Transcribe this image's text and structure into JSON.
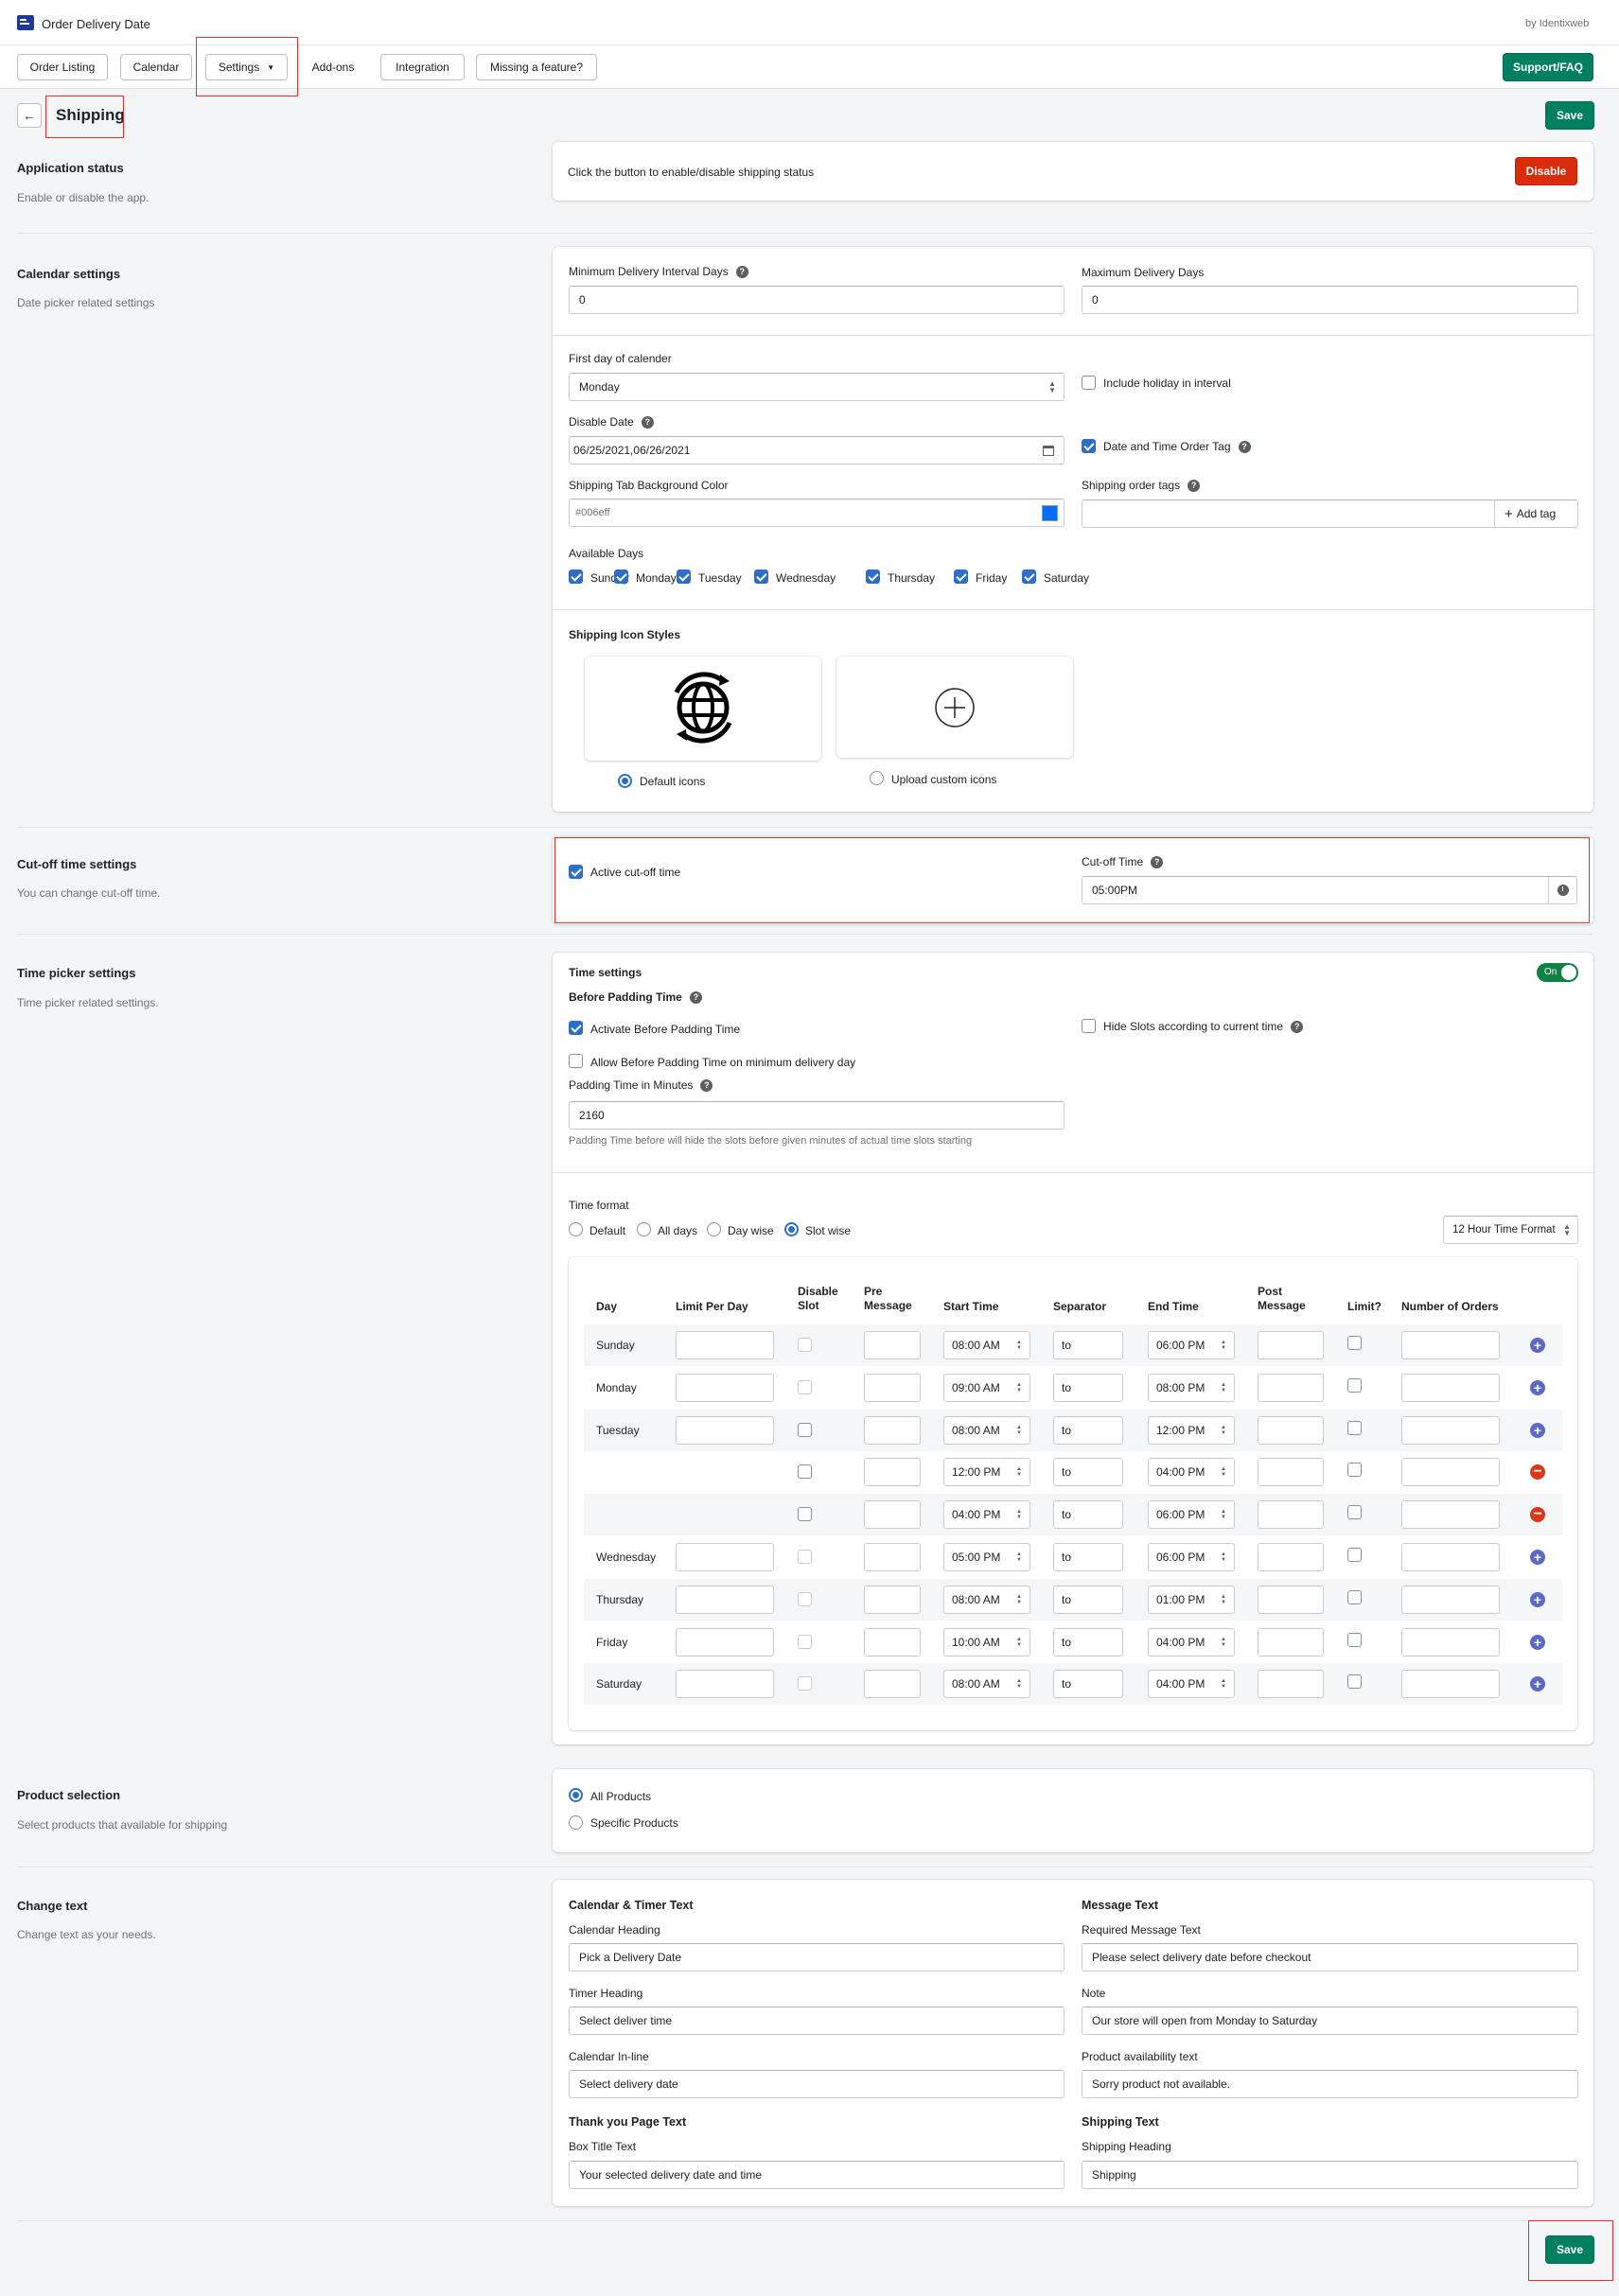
{
  "app": {
    "title": "Order Delivery Date",
    "vendor": "by Identixweb"
  },
  "nav": {
    "order_listing": "Order Listing",
    "calendar": "Calendar",
    "settings": "Settings",
    "addons": "Add-ons",
    "integration": "Integration",
    "missing": "Missing a feature?",
    "support": "Support/FAQ"
  },
  "page": {
    "title": "Shipping",
    "save": "Save"
  },
  "app_status": {
    "title": "Application status",
    "desc": "Enable or disable the app.",
    "text": "Click the button to enable/disable shipping status",
    "button": "Disable"
  },
  "calendar": {
    "title": "Calendar settings",
    "desc": "Date picker related settings",
    "min_label": "Minimum Delivery Interval Days",
    "min_value": "0",
    "max_label": "Maximum Delivery Days",
    "max_value": "0",
    "first_day_label": "First day of calender",
    "first_day_value": "Monday",
    "include_holiday": "Include holiday in interval",
    "disable_date_label": "Disable Date",
    "disable_date_value": "06/25/2021,06/26/2021",
    "order_tag": "Date and Time Order Tag",
    "bg_color_label": "Shipping Tab Background Color",
    "bg_color_value": "#006eff",
    "order_tags_label": "Shipping order tags",
    "add_tag": "Add tag",
    "available_days_label": "Available Days",
    "days": [
      "Sunday",
      "Monday",
      "Tuesday",
      "Wednesday",
      "Thursday",
      "Friday",
      "Saturday"
    ],
    "icon_styles_label": "Shipping Icon Styles",
    "default_icons": "Default icons",
    "custom_icons": "Upload custom icons"
  },
  "cutoff": {
    "title": "Cut-off time settings",
    "desc": "You can change cut-off time.",
    "active": "Active cut-off time",
    "time_label": "Cut-off Time",
    "time_value": "05:00PM"
  },
  "timepicker": {
    "title": "Time picker settings",
    "desc": "Time picker related settings.",
    "settings_title": "Time settings",
    "toggle": "On",
    "before_padding": "Before Padding Time",
    "activate_before": "Activate Before Padding Time",
    "hide_slots": "Hide Slots according to current time",
    "allow_before": "Allow Before Padding Time on minimum delivery day",
    "padding_label": "Padding Time in Minutes",
    "padding_value": "2160",
    "padding_help": "Padding Time before will hide the slots before given minutes of actual time slots starting",
    "format_label": "Time format",
    "format_options": [
      "Default",
      "All days",
      "Day wise",
      "Slot wise"
    ],
    "hour_format": "12 Hour Time Format",
    "table": {
      "headers": {
        "day": "Day",
        "limit": "Limit Per Day",
        "disable1": "Disable",
        "disable2": "Slot",
        "pre1": "Pre",
        "pre2": "Message",
        "start": "Start Time",
        "sep": "Separator",
        "end": "End Time",
        "post1": "Post",
        "post2": "Message",
        "limitq": "Limit?",
        "orders": "Number of Orders"
      },
      "rows": [
        {
          "day": "Sunday",
          "start": "08:00 AM",
          "sep": "to",
          "end": "06:00 PM"
        },
        {
          "day": "Monday",
          "start": "09:00 AM",
          "sep": "to",
          "end": "08:00 PM"
        },
        {
          "day": "Tuesday",
          "start": "08:00 AM",
          "sep": "to",
          "end": "12:00 PM"
        },
        {
          "day": "",
          "start": "12:00 PM",
          "sep": "to",
          "end": "04:00 PM"
        },
        {
          "day": "",
          "start": "04:00 PM",
          "sep": "to",
          "end": "06:00 PM"
        },
        {
          "day": "Wednesday",
          "start": "05:00 PM",
          "sep": "to",
          "end": "06:00 PM"
        },
        {
          "day": "Thursday",
          "start": "08:00 AM",
          "sep": "to",
          "end": "01:00 PM"
        },
        {
          "day": "Friday",
          "start": "10:00 AM",
          "sep": "to",
          "end": "04:00 PM"
        },
        {
          "day": "Saturday",
          "start": "08:00 AM",
          "sep": "to",
          "end": "04:00 PM"
        }
      ]
    }
  },
  "product": {
    "title": "Product selection",
    "desc": "Select products that available for shipping",
    "all": "All Products",
    "specific": "Specific Products"
  },
  "change_text": {
    "title": "Change text",
    "desc": "Change text as your needs.",
    "cal_timer": "Calendar & Timer Text",
    "cal_heading_label": "Calendar Heading",
    "cal_heading_value": "Pick a Delivery Date",
    "timer_heading_label": "Timer Heading",
    "timer_heading_value": "Select deliver time",
    "cal_inline_label": "Calendar In-line",
    "cal_inline_value": "Select delivery date",
    "message_text": "Message Text",
    "required_label": "Required Message Text",
    "required_value": "Please select delivery date before checkout",
    "note_label": "Note",
    "note_value": "Our store will open from Monday to Saturday",
    "availability_label": "Product availability text",
    "availability_value": "Sorry product not available.",
    "thankyou": "Thank you Page Text",
    "box_title_label": "Box Title Text",
    "box_title_value": "Your selected delivery date and time",
    "shipping_text": "Shipping Text",
    "shipping_heading_label": "Shipping Heading",
    "shipping_heading_value": "Shipping"
  }
}
